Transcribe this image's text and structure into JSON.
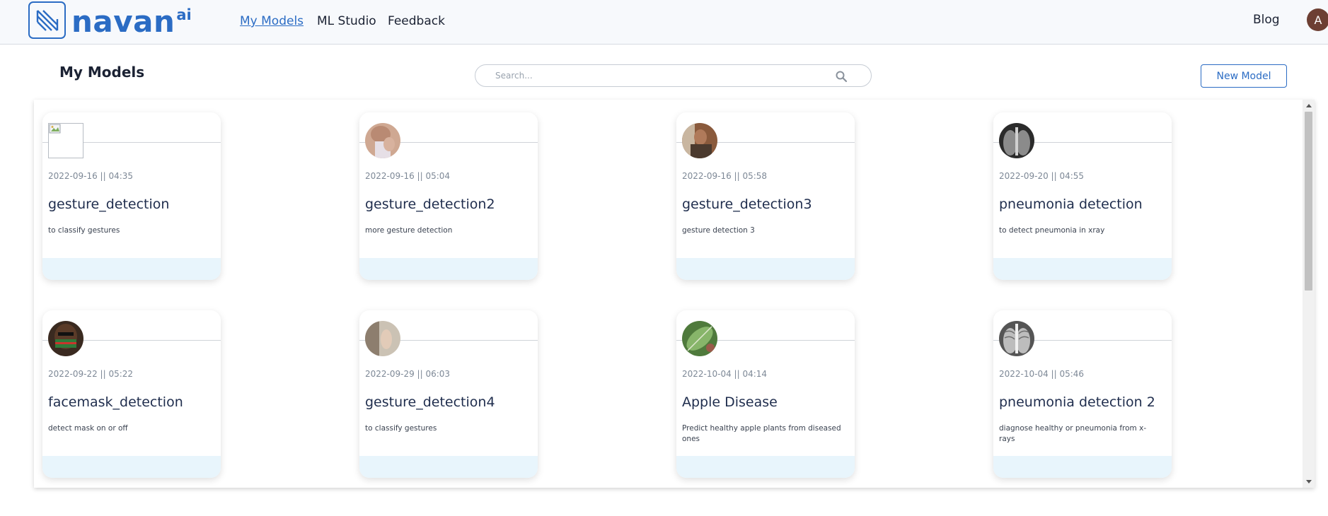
{
  "brand": {
    "name": "navan",
    "superscript": "ai",
    "accent": "#2b6cc4"
  },
  "nav": {
    "items": [
      {
        "label": "My Models",
        "active": true
      },
      {
        "label": "ML Studio",
        "active": false
      },
      {
        "label": "Feedback",
        "active": false
      }
    ],
    "blog": "Blog",
    "user_initial": "A"
  },
  "page": {
    "title": "My Models",
    "search_placeholder": "Search...",
    "search_icon": "search-icon",
    "new_model_label": "New Model"
  },
  "cards": [
    {
      "date": "2022-09-16 || 04:35",
      "name": "gesture_detection",
      "desc": "to classify gestures",
      "thumb": "broken-image"
    },
    {
      "date": "2022-09-16 || 05:04",
      "name": "gesture_detection2",
      "desc": "more gesture detection",
      "thumb": "photo-hand"
    },
    {
      "date": "2022-09-16 || 05:58",
      "name": "gesture_detection3",
      "desc": "gesture detection 3",
      "thumb": "photo-person"
    },
    {
      "date": "2022-09-20 || 04:55",
      "name": "pneumonia detection",
      "desc": "to detect pneumonia in xray",
      "thumb": "photo-xray"
    },
    {
      "date": "2022-09-22 || 05:22",
      "name": "facemask_detection",
      "desc": "detect mask on or off",
      "thumb": "photo-mask"
    },
    {
      "date": "2022-09-29 || 06:03",
      "name": "gesture_detection4",
      "desc": "to classify gestures",
      "thumb": "photo-gesture"
    },
    {
      "date": "2022-10-04 || 04:14",
      "name": "Apple Disease",
      "desc": "Predict healthy apple plants from diseased ones",
      "thumb": "photo-leaf"
    },
    {
      "date": "2022-10-04 || 05:46",
      "name": "pneumonia detection 2",
      "desc": "diagnose healthy or pneumonia from x-rays",
      "thumb": "photo-xray"
    }
  ]
}
